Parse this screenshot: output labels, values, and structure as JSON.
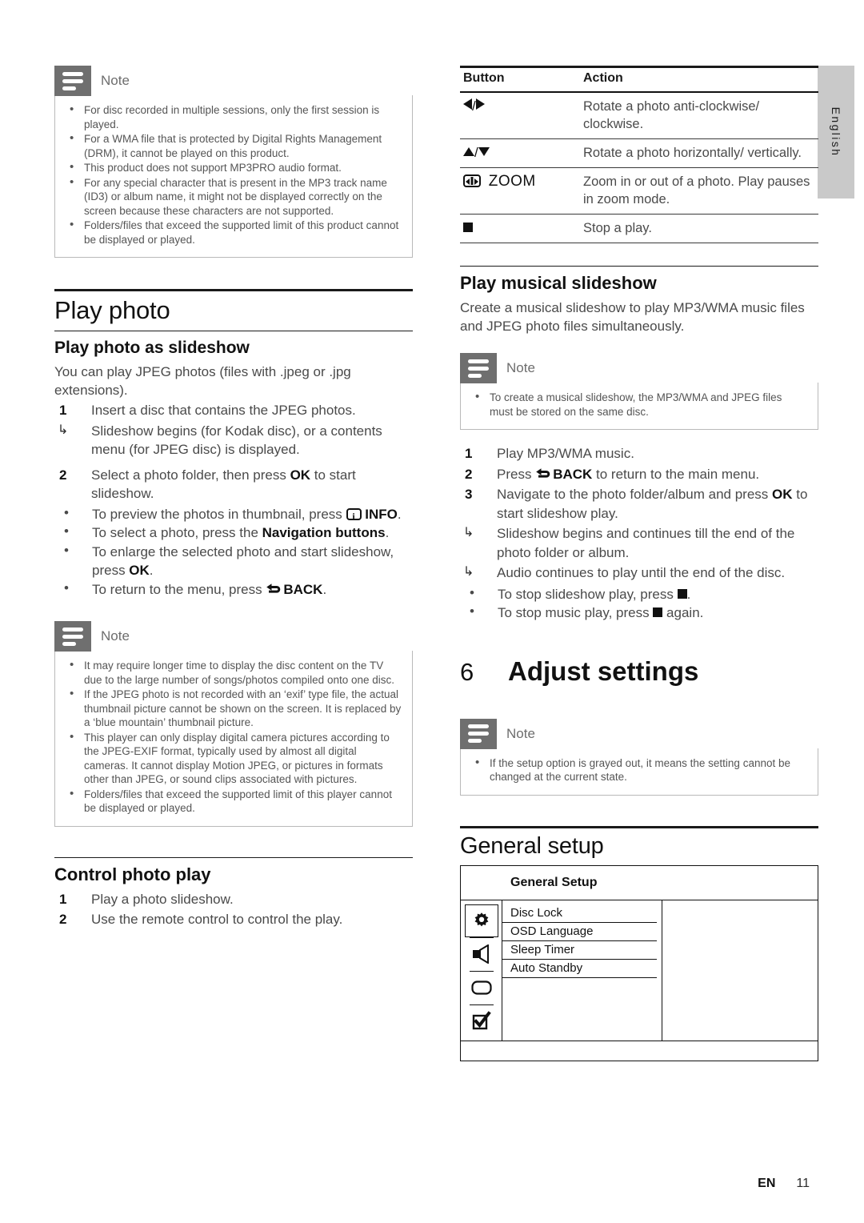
{
  "page": {
    "lang_tab": "English",
    "footer_lang": "EN",
    "footer_page": "11"
  },
  "note_labels": {
    "title": "Note"
  },
  "left": {
    "note1": {
      "title": "Note",
      "items": [
        "For disc recorded in multiple sessions, only the first session is played.",
        "For a WMA file that is protected by Digital Rights Management (DRM), it cannot be played on this product.",
        "This product does not support MP3PRO audio format.",
        "For any special character that is present in the MP3 track name (ID3) or album name, it might not be displayed correctly on the screen because these characters are not supported.",
        "Folders/files that exceed the supported limit of this product cannot be displayed or played."
      ]
    },
    "section_title": "Play photo",
    "sub1_title": "Play photo as slideshow",
    "sub1_intro": "You can play JPEG photos (files with .jpeg or .jpg extensions).",
    "step1_num": "1",
    "step1_text": "Insert a disc that contains the JPEG photos.",
    "step1_arrow": "Slideshow begins (for Kodak disc), or a contents menu (for JPEG disc) is displayed.",
    "step2_num": "2",
    "step2_a": "Select a photo folder, then press ",
    "step2_ok": "OK",
    "step2_b": " to start slideshow.",
    "bullets": {
      "b1_a": "To preview the photos in thumbnail, press ",
      "b1_icon": "info-icon",
      "b1_key": "INFO",
      "b1_b": ".",
      "b2_a": "To select a photo, press the ",
      "b2_key": "Navigation buttons",
      "b2_b": ".",
      "b3_a": "To enlarge the selected photo and start slideshow, press ",
      "b3_key": "OK",
      "b3_b": ".",
      "b4_a": "To return to the menu, press ",
      "b4_icon": "back-icon",
      "b4_key": "BACK",
      "b4_b": "."
    },
    "note2": {
      "title": "Note",
      "items": [
        "It may require longer time to display the disc content on the TV due to the large number of songs/photos compiled onto one disc.",
        "If the JPEG photo is not recorded with an ‘exif’ type file, the actual thumbnail picture cannot be shown on the screen. It is replaced by a ‘blue mountain’ thumbnail picture.",
        "This player can only display digital camera pictures according to the JPEG-EXIF format, typically used by almost all digital cameras. It cannot display Motion JPEG, or pictures in formats other than JPEG, or sound clips associated with pictures.",
        "Folders/files that exceed the supported limit of this player cannot be displayed or played."
      ]
    },
    "sub2_title": "Control photo play",
    "ctrl_step1_num": "1",
    "ctrl_step1_text": "Play a photo slideshow.",
    "ctrl_step2_num": "2",
    "ctrl_step2_text": "Use the remote control to control the play."
  },
  "right": {
    "table": {
      "header_button": "Button",
      "header_action": "Action",
      "rows": [
        {
          "button_icons": "left-right-arrows",
          "button": "◀/▶",
          "action": "Rotate a photo anti-clockwise/ clockwise."
        },
        {
          "button_icons": "up-down-arrows",
          "button": "▲/▼",
          "action": "Rotate a photo horizontally/ vertically."
        },
        {
          "button_icons": "zoom-icon",
          "button": "ZOOM",
          "action": "Zoom in or out of a photo. Play pauses in zoom mode."
        },
        {
          "button_icons": "stop-icon",
          "button": "■",
          "action": "Stop a play."
        }
      ]
    },
    "sub1_title": "Play musical slideshow",
    "sub1_intro": "Create a musical slideshow to play MP3/WMA music files and JPEG photo files simultaneously.",
    "note1": {
      "title": "Note",
      "items": [
        "To create a musical slideshow, the MP3/WMA and JPEG files must be stored on the same disc."
      ]
    },
    "step1_num": "1",
    "step1_text": "Play MP3/WMA music.",
    "step2_num": "2",
    "step2_a": "Press ",
    "step2_key": "BACK",
    "step2_b": " to return to the main menu.",
    "step3_num": "3",
    "step3_a": "Navigate to the photo folder/album and press ",
    "step3_key": "OK",
    "step3_b": " to start slideshow play.",
    "step3_arrow1": "Slideshow begins and continues till the end of the photo folder or album.",
    "step3_arrow2": "Audio continues to play until the end of the disc.",
    "step3_bullet1_a": "To stop slideshow play, press ",
    "step3_bullet1_b": ".",
    "step3_bullet2_a": "To stop music play, press ",
    "step3_bullet2_b": " again.",
    "chapter_num": "6",
    "chapter_title": "Adjust settings",
    "note2": {
      "title": "Note",
      "items": [
        "If the setup option is grayed out, it means the setting cannot be changed at the current state."
      ]
    },
    "section_title": "General setup",
    "osd": {
      "title": "General Setup",
      "icons": [
        "gear-icon",
        "speaker-icon",
        "video-icon",
        "preference-icon"
      ],
      "items": [
        "Disc Lock",
        "OSD Language",
        "Sleep Timer",
        "Auto Standby"
      ]
    }
  }
}
